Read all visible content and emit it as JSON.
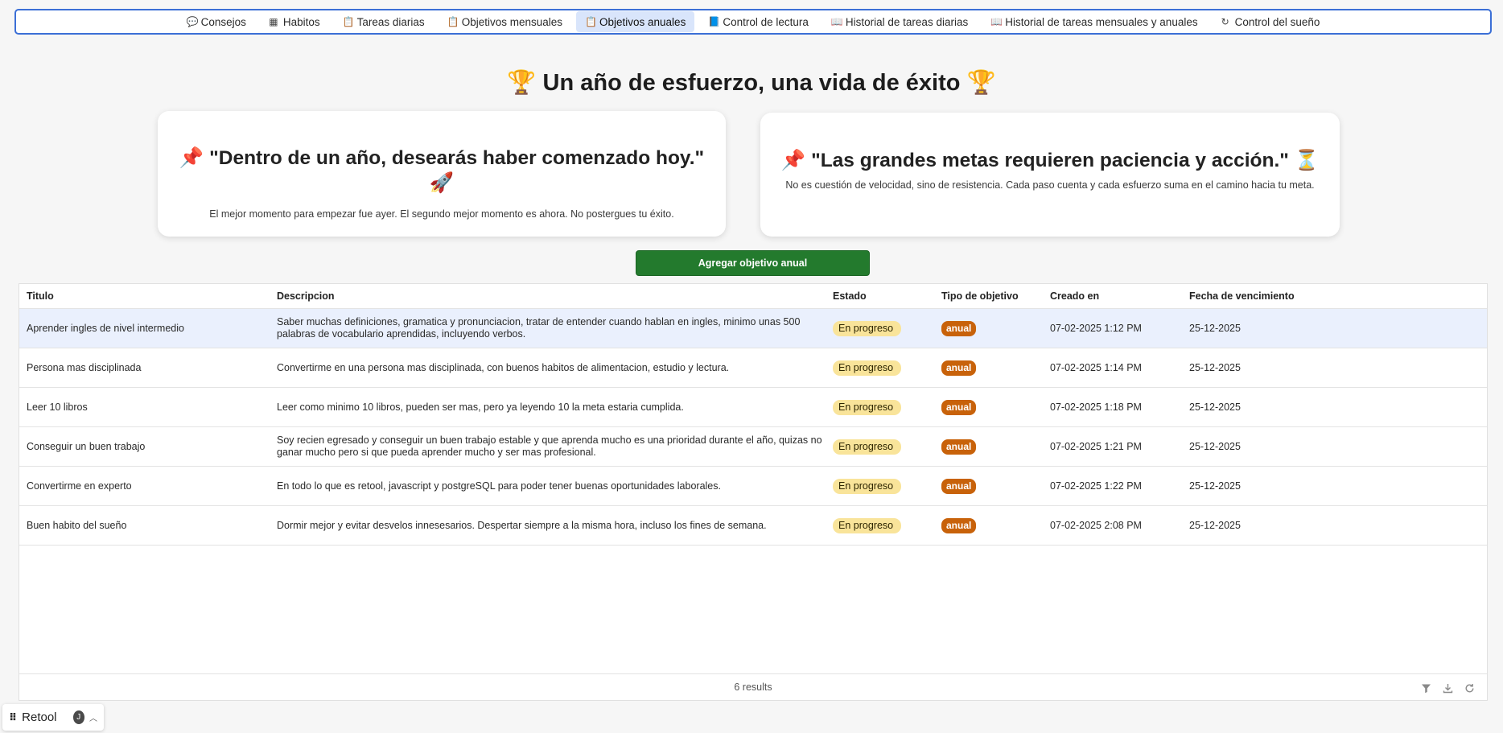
{
  "nav": {
    "items": [
      {
        "label": "Consejos",
        "icon": "chat-icon",
        "glyph": "💬",
        "active": false
      },
      {
        "label": "Habitos",
        "icon": "calendar-icon",
        "glyph": "▦",
        "active": false
      },
      {
        "label": "Tareas diarias",
        "icon": "clipboard-icon",
        "glyph": "📋",
        "active": false
      },
      {
        "label": "Objetivos mensuales",
        "icon": "clipboard-icon",
        "glyph": "📋",
        "active": false
      },
      {
        "label": "Objetivos anuales",
        "icon": "clipboard-icon",
        "glyph": "📋",
        "active": true
      },
      {
        "label": "Control de lectura",
        "icon": "book-icon",
        "glyph": "📘",
        "active": false
      },
      {
        "label": "Historial de tareas diarias",
        "icon": "open-book-icon",
        "glyph": "📖",
        "active": false
      },
      {
        "label": "Historial de tareas mensuales y anuales",
        "icon": "open-book-icon",
        "glyph": "📖",
        "active": false
      },
      {
        "label": "Control del sueño",
        "icon": "refresh-icon",
        "glyph": "↻",
        "active": false
      }
    ]
  },
  "hero": {
    "title": "🏆 Un año de esfuerzo, una vida de éxito 🏆"
  },
  "cards": [
    {
      "quote": "📌 \"Dentro de un año, desearás haber comenzado hoy.\" 🚀",
      "subtitle": "El mejor momento para empezar fue ayer. El segundo mejor momento es ahora. No postergues tu éxito."
    },
    {
      "quote": "📌 \"Las grandes metas requieren paciencia y acción.\" ⏳",
      "subtitle": "No es cuestión de velocidad, sino de resistencia. Cada paso cuenta y cada esfuerzo suma en el camino hacia tu meta."
    }
  ],
  "add_button": {
    "label": "Agregar objetivo anual"
  },
  "table": {
    "columns": [
      "Titulo",
      "Descripcion",
      "Estado",
      "Tipo de objetivo",
      "Creado en",
      "Fecha de vencimiento"
    ],
    "rows": [
      {
        "titulo": "Aprender ingles de nivel intermedio",
        "descripcion": "Saber muchas definiciones, gramatica y pronunciacion, tratar de entender cuando hablan en ingles, minimo unas 500 palabras de vocabulario aprendidas, incluyendo verbos.",
        "estado": "En progreso",
        "tipo": "anual",
        "creado": "07-02-2025 1:12 PM",
        "vencimiento": "25-12-2025"
      },
      {
        "titulo": "Persona mas disciplinada",
        "descripcion": "Convertirme en una persona mas disciplinada, con buenos habitos de alimentacion, estudio y lectura.",
        "estado": "En progreso",
        "tipo": "anual",
        "creado": "07-02-2025 1:14 PM",
        "vencimiento": "25-12-2025"
      },
      {
        "titulo": "Leer 10 libros",
        "descripcion": "Leer como minimo 10 libros, pueden ser mas, pero ya leyendo 10 la meta estaria cumplida.",
        "estado": "En progreso",
        "tipo": "anual",
        "creado": "07-02-2025 1:18 PM",
        "vencimiento": "25-12-2025"
      },
      {
        "titulo": "Conseguir un buen trabajo",
        "descripcion": "Soy recien egresado y conseguir un buen trabajo estable y que aprenda mucho es una prioridad durante el año, quizas no ganar mucho pero si que pueda aprender mucho y ser mas profesional.",
        "estado": "En progreso",
        "tipo": "anual",
        "creado": "07-02-2025 1:21 PM",
        "vencimiento": "25-12-2025"
      },
      {
        "titulo": "Convertirme en experto",
        "descripcion": "En todo lo que es retool, javascript y postgreSQL para poder tener buenas oportunidades laborales.",
        "estado": "En progreso",
        "tipo": "anual",
        "creado": "07-02-2025 1:22 PM",
        "vencimiento": "25-12-2025"
      },
      {
        "titulo": "Buen habito del sueño",
        "descripcion": "Dormir mejor y evitar desvelos innesesarios. Despertar siempre a la misma hora, incluso los fines de semana.",
        "estado": "En progreso",
        "tipo": "anual",
        "creado": "07-02-2025 2:08 PM",
        "vencimiento": "25-12-2025"
      }
    ],
    "selected_row": 0,
    "footer": {
      "results": "6 results"
    }
  },
  "retool": {
    "label": "Retool",
    "avatar": "J"
  },
  "colors": {
    "accent": "#3b6fd6",
    "button": "#237a2d",
    "estado_pill": "#f9e49a",
    "tipo_pill": "#c8620a",
    "selected_row": "#eaf0fd"
  }
}
